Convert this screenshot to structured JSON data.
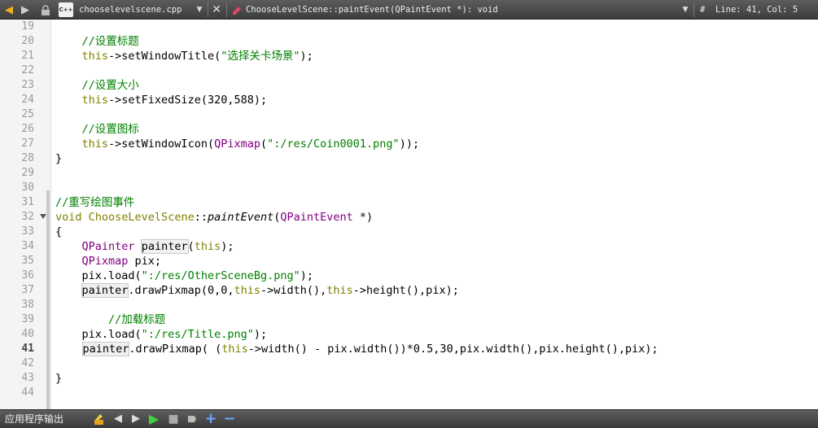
{
  "toolbar": {
    "file_name": "chooselevelscene.cpp",
    "file_icon_text": "C++",
    "function_name": "ChooseLevelScene::paintEvent(QPaintEvent *): void",
    "hash": "#",
    "position": "Line: 41, Col: 5"
  },
  "line_numbers": [
    "19",
    "20",
    "21",
    "22",
    "23",
    "24",
    "25",
    "26",
    "27",
    "28",
    "29",
    "30",
    "31",
    "32",
    "33",
    "34",
    "35",
    "36",
    "37",
    "38",
    "39",
    "40",
    "41",
    "42",
    "43",
    "44"
  ],
  "code_lines": [
    [
      {
        "t": "    "
      }
    ],
    [
      {
        "t": "    "
      },
      {
        "t": "//设置标题",
        "c": "cm"
      }
    ],
    [
      {
        "t": "    "
      },
      {
        "t": "this",
        "c": "kw"
      },
      {
        "t": "->setWindowTitle("
      },
      {
        "t": "\"选择关卡场景\"",
        "c": "str"
      },
      {
        "t": ");"
      }
    ],
    [
      {
        "t": ""
      }
    ],
    [
      {
        "t": "    "
      },
      {
        "t": "//设置大小",
        "c": "cm"
      }
    ],
    [
      {
        "t": "    "
      },
      {
        "t": "this",
        "c": "kw"
      },
      {
        "t": "->setFixedSize(320,588);"
      }
    ],
    [
      {
        "t": ""
      }
    ],
    [
      {
        "t": "    "
      },
      {
        "t": "//设置图标",
        "c": "cm"
      }
    ],
    [
      {
        "t": "    "
      },
      {
        "t": "this",
        "c": "kw"
      },
      {
        "t": "->setWindowIcon("
      },
      {
        "t": "QPixmap",
        "c": "ty"
      },
      {
        "t": "("
      },
      {
        "t": "\":/res/Coin0001.png\"",
        "c": "str"
      },
      {
        "t": "));"
      }
    ],
    [
      {
        "t": "}"
      }
    ],
    [
      {
        "t": ""
      }
    ],
    [
      {
        "t": ""
      }
    ],
    [
      {
        "t": "//重写绘图事件",
        "c": "cm"
      }
    ],
    [
      {
        "t": "void",
        "c": "kw"
      },
      {
        "t": " "
      },
      {
        "t": "ChooseLevelScene",
        "c": "kw"
      },
      {
        "t": "::"
      },
      {
        "t": "paintEvent",
        "c": "it"
      },
      {
        "t": "("
      },
      {
        "t": "QPaintEvent",
        "c": "ty"
      },
      {
        "t": " *)"
      }
    ],
    [
      {
        "t": "{"
      }
    ],
    [
      {
        "t": "    "
      },
      {
        "t": "QPainter",
        "c": "ty"
      },
      {
        "t": " "
      },
      {
        "t": "painter",
        "c": "hl"
      },
      {
        "t": "("
      },
      {
        "t": "this",
        "c": "kw"
      },
      {
        "t": ");"
      }
    ],
    [
      {
        "t": "    "
      },
      {
        "t": "QPixmap",
        "c": "ty"
      },
      {
        "t": " pix;"
      }
    ],
    [
      {
        "t": "    "
      },
      {
        "t": "pix.load("
      },
      {
        "t": "\":/res/OtherSceneBg.png\"",
        "c": "str"
      },
      {
        "t": ");"
      }
    ],
    [
      {
        "t": "    "
      },
      {
        "t": "painter",
        "c": "hl"
      },
      {
        "t": ".drawPixmap(0,0,"
      },
      {
        "t": "this",
        "c": "kw"
      },
      {
        "t": "->width(),"
      },
      {
        "t": "this",
        "c": "kw"
      },
      {
        "t": "->height(),pix);"
      }
    ],
    [
      {
        "t": ""
      }
    ],
    [
      {
        "t": "        "
      },
      {
        "t": "//加载标题",
        "c": "cm"
      }
    ],
    [
      {
        "t": "    "
      },
      {
        "t": "pix.load("
      },
      {
        "t": "\":/res/Title.png\"",
        "c": "str"
      },
      {
        "t": ");"
      }
    ],
    [
      {
        "t": "    "
      },
      {
        "t": "CURSOR",
        "c": "cursor"
      },
      {
        "t": "painter",
        "c": "hl"
      },
      {
        "t": ".drawPixmap( ("
      },
      {
        "t": "this",
        "c": "kw"
      },
      {
        "t": "->width() - pix.width())*0.5,30,pix.width(),pix.height(),pix);"
      }
    ],
    [
      {
        "t": ""
      }
    ],
    [
      {
        "t": "}"
      }
    ],
    [
      {
        "t": ""
      }
    ]
  ],
  "current_line_index": 22,
  "fold_lines": [
    13
  ],
  "output_pane": {
    "label": "应用程序输出"
  },
  "icons": [
    "arrow-left-icon",
    "arrow-right-icon",
    "lock-icon",
    "file-cpp-icon",
    "dropdown-icon",
    "close-icon",
    "bookmark-icon",
    "build-icon",
    "run-icon",
    "stop-icon",
    "attach-icon",
    "zoom-in-icon",
    "zoom-out-icon"
  ],
  "colors": {
    "keyword": "#808000",
    "type": "#800080",
    "string": "#008000",
    "comment": "#008000",
    "toolbar_bg": "#4a4a4a",
    "gutter_bg": "#f4f4f4"
  }
}
